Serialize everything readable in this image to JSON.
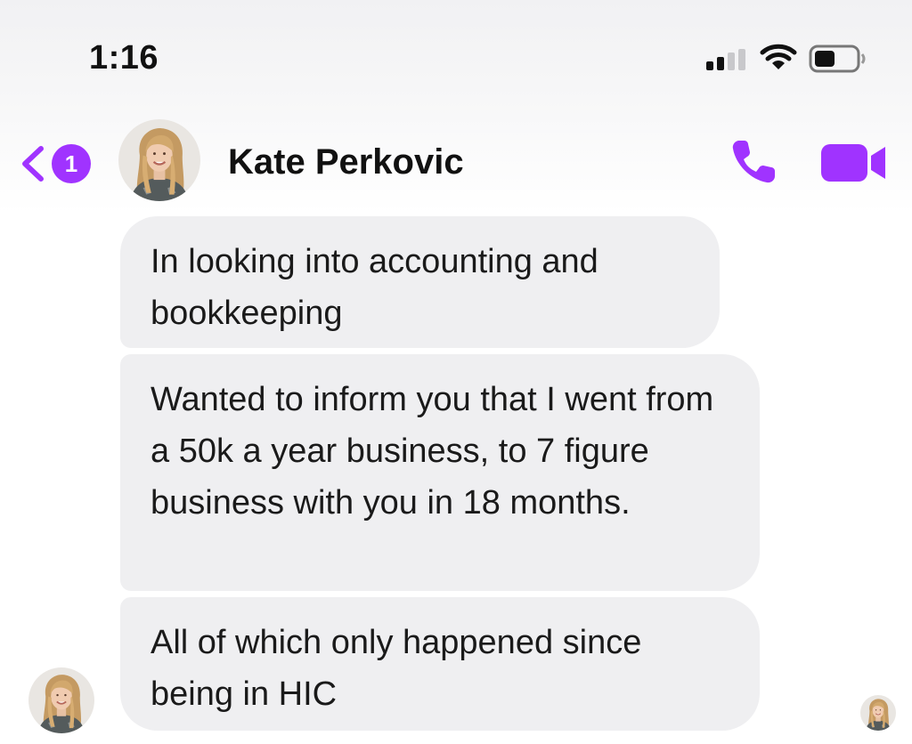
{
  "status_bar": {
    "time": "1:16",
    "icons": [
      "cellular-signal-icon",
      "wifi-icon",
      "battery-icon"
    ]
  },
  "header": {
    "back_icon": "chevron-left-icon",
    "unread_count": "1",
    "contact_name": "Kate Perkovic",
    "avatar": "contact-avatar",
    "actions": [
      "phone-icon",
      "video-camera-icon"
    ]
  },
  "messages": [
    {
      "sender": "Kate Perkovic",
      "text": "In looking into accounting and bookkeeping"
    },
    {
      "sender": "Kate Perkovic",
      "text": "Wanted to inform you that I went from a 50k a year business, to 7 figure business with you in 18 months."
    },
    {
      "sender": "Kate Perkovic",
      "text": "All of which only happened since being in HIC"
    }
  ],
  "colors": {
    "accent": "#a033ff",
    "bubble_bg": "#efeff1",
    "header_bg": "#f4f4f5",
    "text": "#1a1a1a"
  }
}
